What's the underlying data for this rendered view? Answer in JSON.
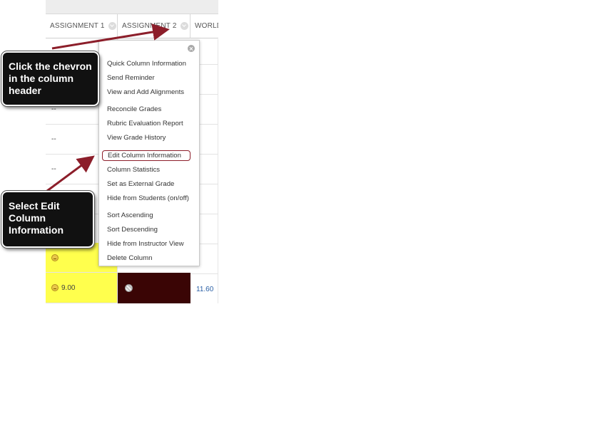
{
  "grid": {
    "columns": [
      {
        "header": "ASSIGNMENT 1"
      },
      {
        "header": "ASSIGNMENT 2"
      },
      {
        "header": "WORLD"
      }
    ],
    "col1_cells": [
      "--",
      "--",
      "--"
    ],
    "col3_dashes": [
      "-",
      "-",
      "-",
      "-",
      "-",
      "-",
      "-"
    ],
    "last_row": {
      "col1": "9.00",
      "col3": "11.60"
    }
  },
  "menu": {
    "groups": [
      [
        "Quick Column Information",
        "Send Reminder",
        "View and Add Alignments"
      ],
      [
        "Reconcile Grades",
        "Rubric Evaluation Report",
        "View Grade History"
      ],
      [
        "Edit Column Information",
        "Column Statistics",
        "Set as External Grade",
        "Hide from Students (on/off)"
      ],
      [
        "Sort Ascending",
        "Sort Descending",
        "Hide from Instructor View",
        "Delete Column"
      ]
    ],
    "highlighted": "Edit Column Information"
  },
  "callouts": [
    {
      "text": "Click the chevron\nin the column\nheader"
    },
    {
      "text": "Select Edit\nColumn\nInformation"
    }
  ],
  "colors": {
    "arrow": "#8c1e2a",
    "yellow": "#ffff4d",
    "dark_cell": "#3a0505",
    "link": "#2a5fa5"
  }
}
